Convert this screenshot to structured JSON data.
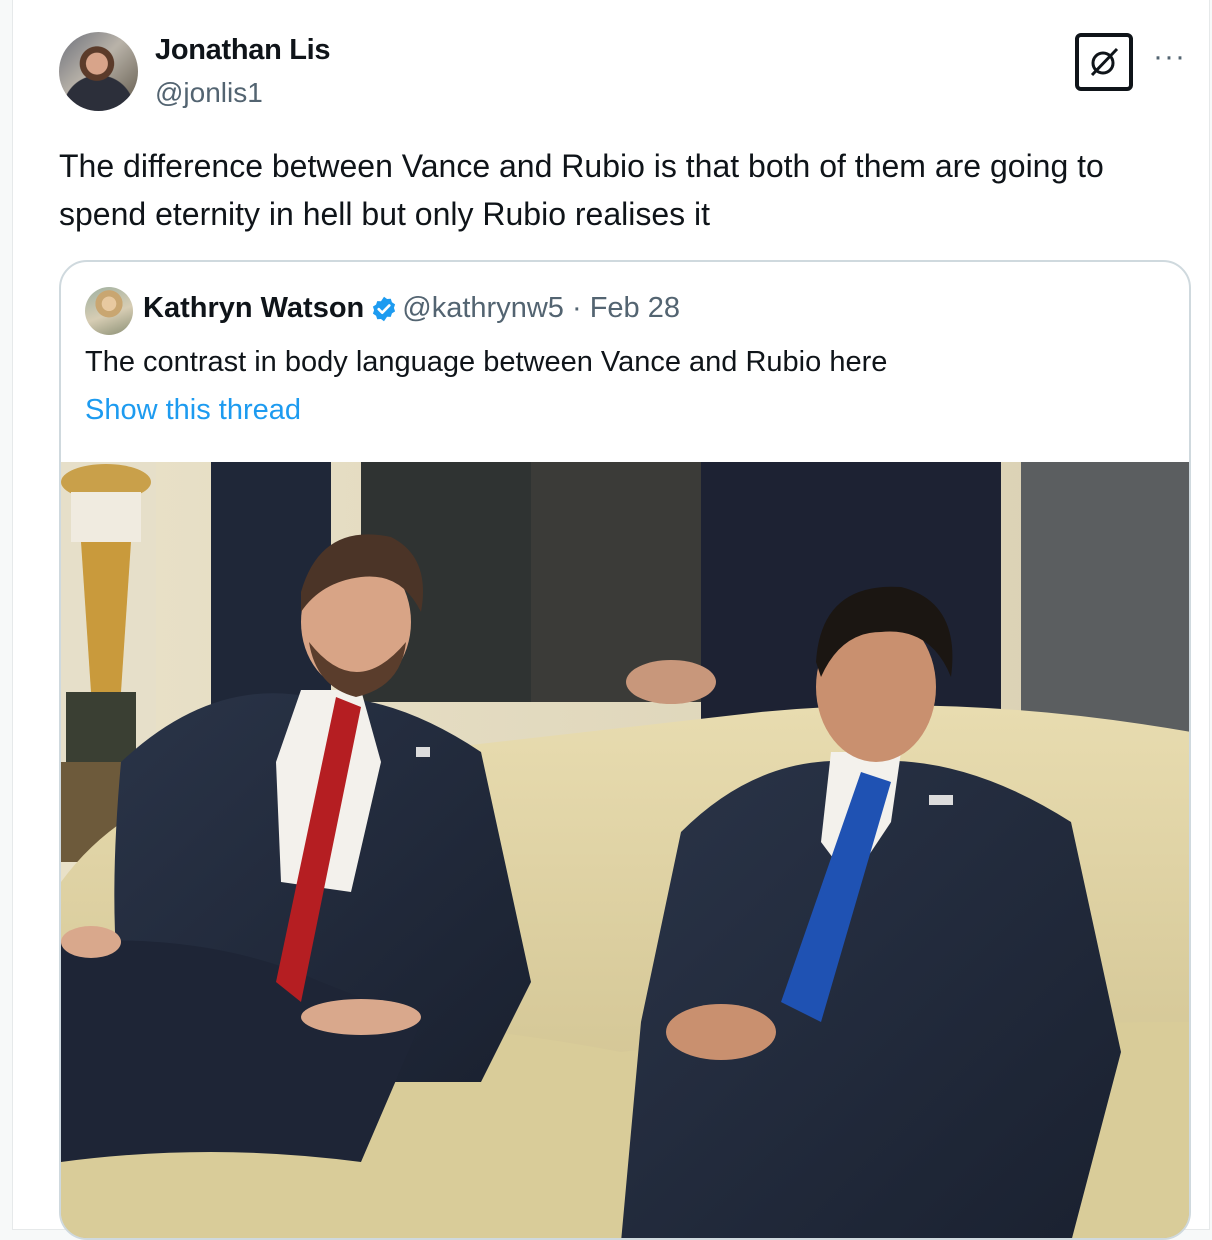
{
  "tweet": {
    "author_name": "Jonathan Lis",
    "author_handle": "@jonlis1",
    "text": "The difference between Vance and Rubio is that both of them are going to spend eternity in hell but only Rubio realises it",
    "grok_icon": "grok-icon",
    "more_label": "···"
  },
  "quoted": {
    "author_name": "Kathryn Watson",
    "verified_icon": "verified-badge-icon",
    "author_handle": "@kathrynw5",
    "separator": "·",
    "date": "Feb 28",
    "text": "The contrast in body language between Vance and Rubio here",
    "show_thread": "Show this thread"
  },
  "colors": {
    "link": "#1d9bf0",
    "secondary_text": "#536471",
    "border": "#cfd9de"
  }
}
